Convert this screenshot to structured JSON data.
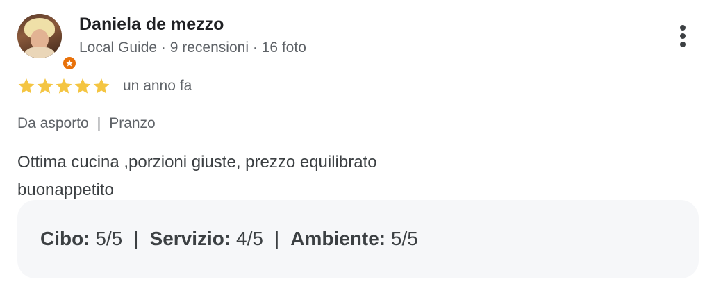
{
  "reviewer": {
    "name": "Daniela de mezzo",
    "role": "Local Guide",
    "reviews": "9 recensioni",
    "photos": "16 foto",
    "separator": " · ",
    "badge_color": "#e8710a"
  },
  "review": {
    "stars": 5,
    "star_color": "#f4c542",
    "date": "un anno fa",
    "tags": [
      "Da asporto",
      "Pranzo"
    ],
    "tag_separator": "|",
    "text_lines": [
      "Ottima cucina ,porzioni giuste, prezzo equilibrato",
      "buonappetito"
    ]
  },
  "ratings": [
    {
      "label": "Cibo:",
      "value": "5/5"
    },
    {
      "label": "Servizio:",
      "value": "4/5"
    },
    {
      "label": "Ambiente:",
      "value": "5/5"
    }
  ],
  "ratings_separator": "|",
  "icons": {
    "more": "more-vert-icon",
    "badge": "local-guide-star-icon",
    "star": "star-icon"
  }
}
